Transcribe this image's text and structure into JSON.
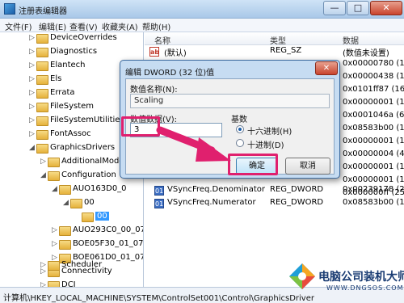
{
  "window": {
    "title": "注册表编辑器",
    "minimize": "—",
    "maximize": "□",
    "close": "✕"
  },
  "menu": [
    "文件(F)",
    "编辑(E)",
    "查看(V)",
    "收藏夹(A)",
    "帮助(H)"
  ],
  "tree": [
    {
      "label": "DeviceOverrides",
      "arrow": "▷"
    },
    {
      "label": "Diagnostics",
      "arrow": "▷"
    },
    {
      "label": "Elantech",
      "arrow": "▷"
    },
    {
      "label": "Els",
      "arrow": "▷"
    },
    {
      "label": "Errata",
      "arrow": "▷"
    },
    {
      "label": "FileSystem",
      "arrow": "▷"
    },
    {
      "label": "FileSystemUtilities",
      "arrow": "▷"
    },
    {
      "label": "FontAssoc",
      "arrow": "▷"
    },
    {
      "label": "GraphicsDrivers",
      "arrow": "◢"
    },
    {
      "label": "AdditionalMode",
      "arrow": "▷"
    },
    {
      "label": "Configuration",
      "arrow": "◢"
    },
    {
      "label": "AUO163D0_0",
      "arrow": "◢"
    },
    {
      "label": "00",
      "arrow": "◢"
    },
    {
      "label": "00",
      "arrow": ""
    },
    {
      "label": "AUO293C0_00_07",
      "arrow": "▷"
    },
    {
      "label": "BOE05F30_01_07D",
      "arrow": "▷"
    },
    {
      "label": "BOE061D0_01_07",
      "arrow": "▷"
    },
    {
      "label": "Connectivity",
      "arrow": "▷"
    },
    {
      "label": "DCI",
      "arrow": "▷"
    },
    {
      "label": "Scheduler",
      "arrow": "▷"
    }
  ],
  "columns": {
    "name": "名称",
    "type": "类型",
    "data": "数据"
  },
  "values": [
    {
      "name": "(默认)",
      "type": "REG_SZ",
      "data": "(数值未设置)",
      "icon": "ab"
    },
    {
      "name": "",
      "type": "",
      "data": "0x00000780 (19",
      "icon": "bin"
    },
    {
      "name": "",
      "type": "",
      "data": "0x00000438 (10",
      "icon": "bin"
    },
    {
      "name": "",
      "type": "",
      "data": "0x0101ff87 (169",
      "icon": "bin"
    },
    {
      "name": "",
      "type": "",
      "data": "0x00000001 (1)",
      "icon": "bin"
    },
    {
      "name": "",
      "type": "",
      "data": "0x0001046a (66",
      "icon": "bin"
    },
    {
      "name": "",
      "type": "",
      "data": "0x08583b00 (14",
      "icon": "bin"
    },
    {
      "name": "",
      "type": "",
      "data": "0x00000001 (1)",
      "icon": "bin"
    },
    {
      "name": "",
      "type": "",
      "data": "0x00000004 (4)",
      "icon": "bin"
    },
    {
      "name": "",
      "type": "",
      "data": "0x00000001 (1)",
      "icon": "bin"
    },
    {
      "name": "",
      "type": "",
      "data": "0x00000001 (1)",
      "icon": "bin"
    },
    {
      "name": "",
      "type": "",
      "data": "0x000000ff (255",
      "icon": "bin"
    },
    {
      "name": "VSyncFreq.Denominator",
      "type": "REG_DWORD",
      "data": "0x00239178 (23",
      "icon": "bin"
    },
    {
      "name": "VSyncFreq.Numerator",
      "type": "REG_DWORD",
      "data": "0x08583b00 (14",
      "icon": "bin"
    }
  ],
  "status_path": "计算机\\HKEY_LOCAL_MACHINE\\SYSTEM\\ControlSet001\\Control\\GraphicsDriver",
  "dialog": {
    "title": "编辑 DWORD (32 位)值",
    "close": "✕",
    "name_label": "数值名称(N):",
    "name_value": "Scaling",
    "data_label": "数值数据(V):",
    "data_value": "3",
    "base_label": "基数",
    "hex_label": "十六进制(H)",
    "dec_label": "十进制(D)",
    "base_selected": "hex",
    "ok": "确定",
    "cancel": "取消"
  },
  "watermark": {
    "text": "电脑公司装机大师",
    "sub": "WWW.DNGSOS.COM"
  },
  "colors": {
    "highlight": "#e0206e",
    "selection": "#3399ff",
    "title_gradient": "#cfe3f6"
  }
}
